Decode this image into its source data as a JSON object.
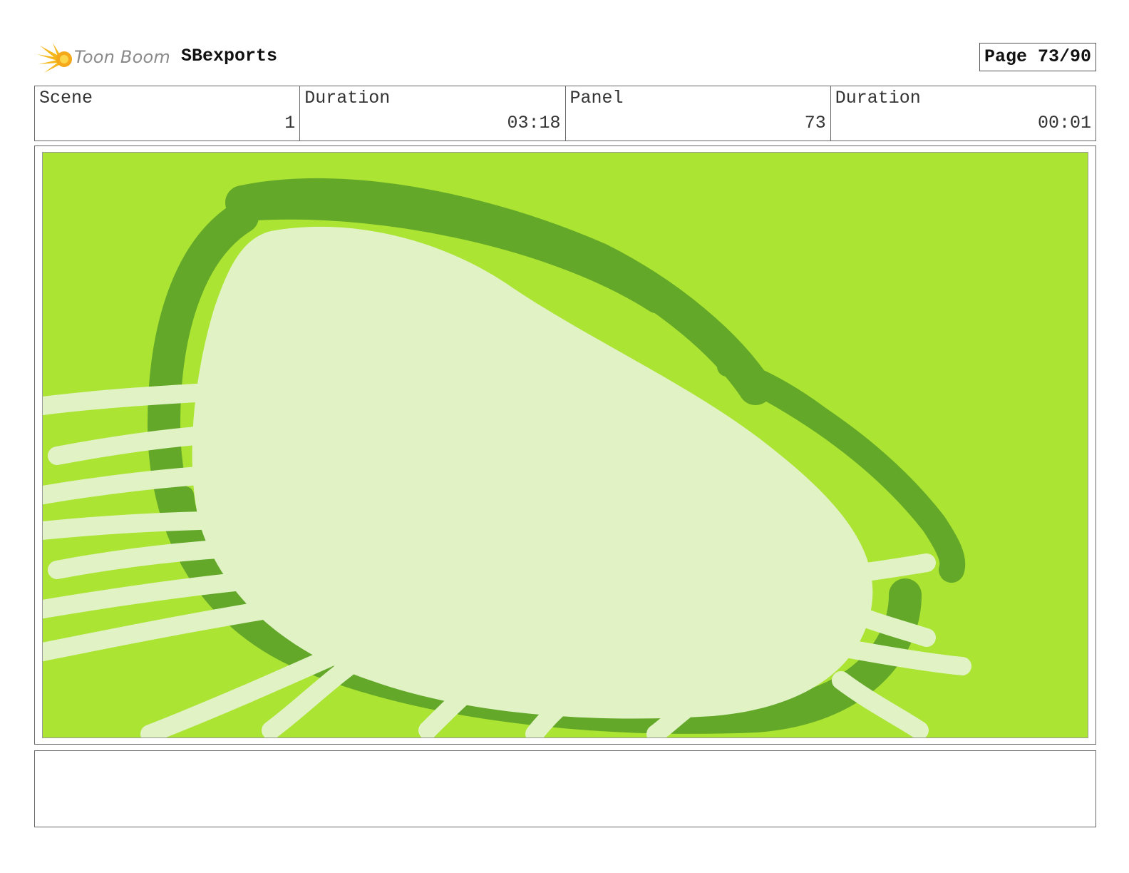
{
  "header": {
    "logo_text": "Toon Boom",
    "project_name": "SBexports",
    "page": "Page 73/90"
  },
  "info": [
    {
      "label": "Scene",
      "value": "1"
    },
    {
      "label": "Duration",
      "value": "03:18"
    },
    {
      "label": "Panel",
      "value": "73"
    },
    {
      "label": "Duration",
      "value": "00:01"
    }
  ],
  "panel": {
    "background_color": "#abe433",
    "dark_stroke_color": "#63a828",
    "light_shape_color": "#e1f2c5"
  },
  "notes": {
    "text": ""
  }
}
